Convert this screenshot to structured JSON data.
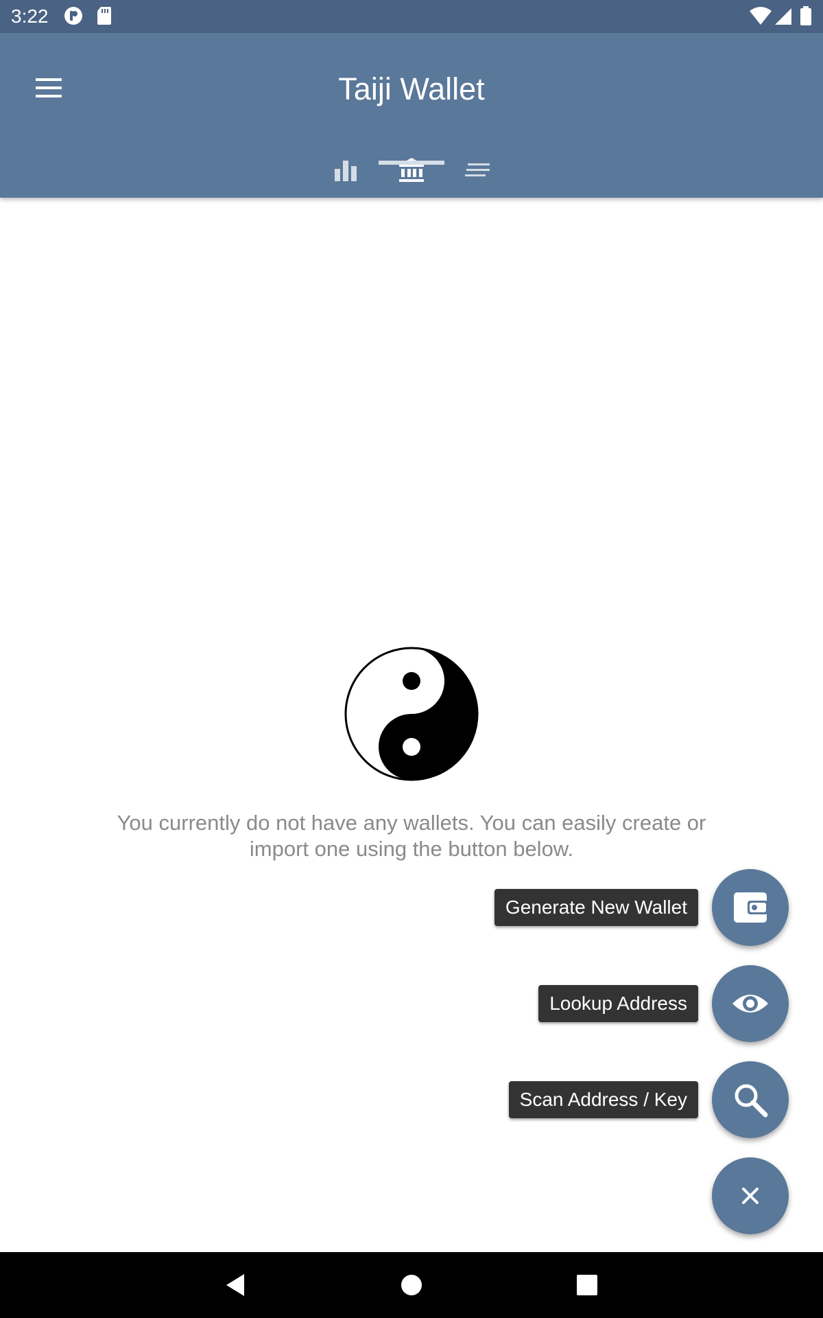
{
  "status_bar": {
    "time": "3:22",
    "left_icons": [
      "app-notification-icon",
      "sd-card-icon"
    ],
    "right_icons": [
      "wifi-icon",
      "signal-icon",
      "battery-icon"
    ]
  },
  "app_bar": {
    "title": "Taiji Wallet",
    "menu_icon": "hamburger-menu-icon",
    "tabs": [
      {
        "icon": "bar-chart-icon",
        "selected": false
      },
      {
        "icon": "bank-icon",
        "selected": true
      },
      {
        "icon": "list-icon",
        "selected": false
      }
    ]
  },
  "empty_state": {
    "icon": "yin-yang-icon",
    "message": "You currently do not have any wallets. You can easily create or import one using the button below."
  },
  "fab_menu": {
    "items": [
      {
        "label": "Generate New Wallet",
        "icon": "wallet-icon"
      },
      {
        "label": "Lookup Address",
        "icon": "eye-icon"
      },
      {
        "label": "Scan Address / Key",
        "icon": "search-icon"
      }
    ],
    "close_icon": "close-icon"
  },
  "nav_bar": {
    "icons": [
      "back-icon",
      "home-icon",
      "recents-icon"
    ]
  },
  "colors": {
    "status_bar": "#4a6284",
    "primary": "#5a7899",
    "label_bg": "#333333",
    "message_text": "#8a8a8a"
  }
}
